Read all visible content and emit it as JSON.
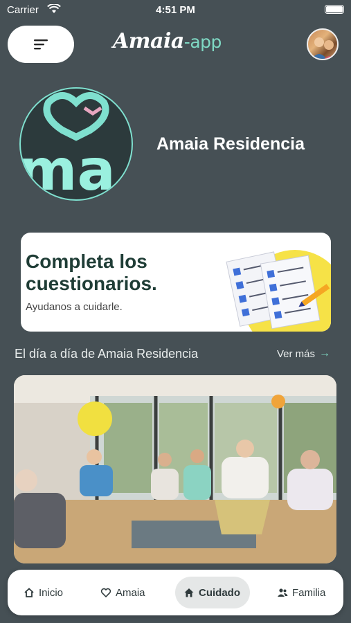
{
  "status_bar": {
    "carrier": "Carrier",
    "time": "4:51 PM"
  },
  "header": {
    "logo_main": "Amaia",
    "logo_suffix": "-app",
    "menu_icon": "sort-lines-icon",
    "avatar_icon": "user-avatar-icon"
  },
  "residence": {
    "logo_text": "ma",
    "name": "Amaia Residencia"
  },
  "banner": {
    "title": "Completa los cuestionarios.",
    "subtitle": "Ayudanos a cuidarle."
  },
  "daily": {
    "title": "El día a día de Amaia Residencia",
    "see_more": "Ver más",
    "photo_icon": "residence-activity-photo"
  },
  "tabs": [
    {
      "label": "Inicio",
      "icon": "home-outline-icon",
      "active": false
    },
    {
      "label": "Amaia",
      "icon": "heart-icon",
      "active": false
    },
    {
      "label": "Cuidado",
      "icon": "home-filled-icon",
      "active": true
    },
    {
      "label": "Familia",
      "icon": "people-icon",
      "active": false
    }
  ],
  "colors": {
    "background": "#465055",
    "accent": "#7fd9c4",
    "banner_yellow": "#f6e247",
    "banner_title": "#1f3d36"
  }
}
